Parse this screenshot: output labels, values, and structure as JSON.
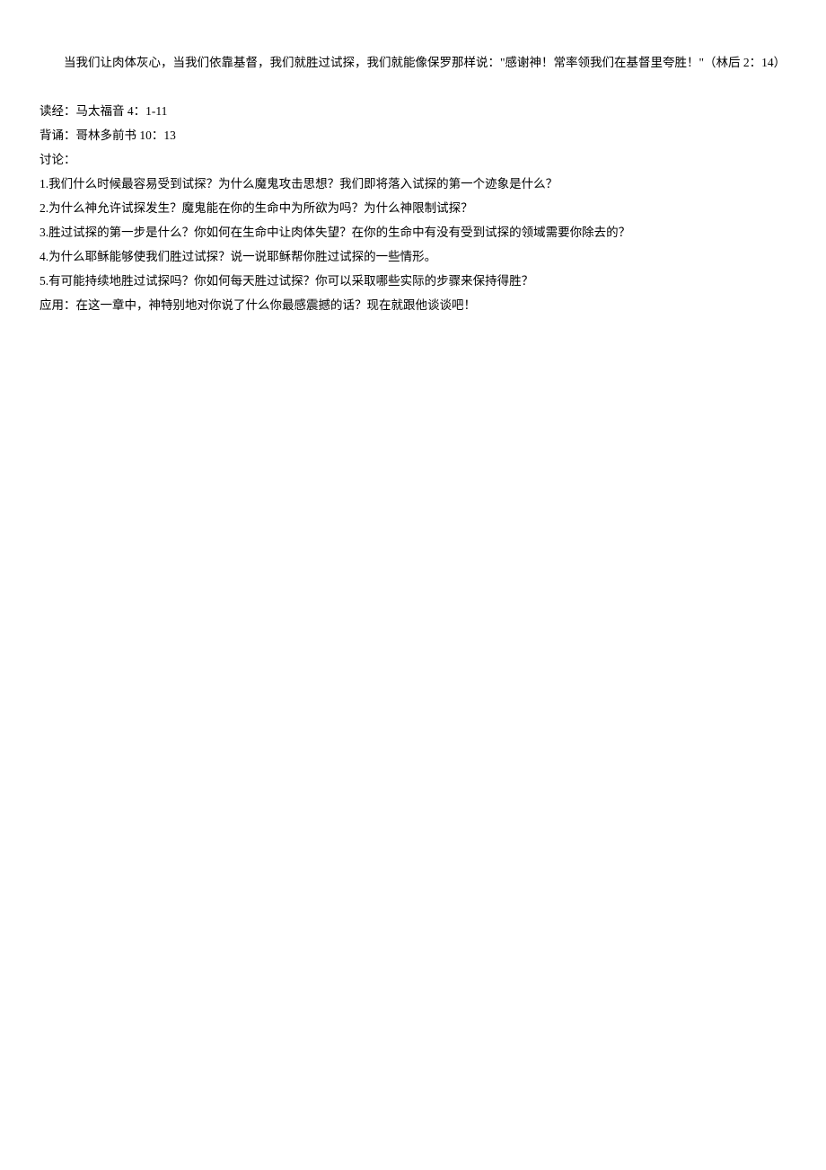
{
  "intro": {
    "paragraph1": "当我们让肉体灰心，当我们依靠基督，我们就胜过试探，我们就能像保罗那样说：\"感谢神！常率领我们在基督里夸胜！\"（林后 2：14）"
  },
  "reading": {
    "label": "读经：",
    "content": "马太福音 4：1-11"
  },
  "memory": {
    "label": "背诵：",
    "content": "哥林多前书 10：13"
  },
  "discussion": {
    "label": "讨论：",
    "questions": [
      "1.我们什么时候最容易受到试探？为什么魔鬼攻击思想？我们即将落入试探的第一个迹象是什么？",
      "2.为什么神允许试探发生？魔鬼能在你的生命中为所欲为吗？为什么神限制试探？",
      "3.胜过试探的第一步是什么？你如何在生命中让肉体失望？在你的生命中有没有受到试探的领域需要你除去的？",
      "4.为什么耶稣能够使我们胜过试探？说一说耶稣帮你胜过试探的一些情形。",
      "5.有可能持续地胜过试探吗？你如何每天胜过试探？你可以采取哪些实际的步骤来保持得胜？"
    ]
  },
  "application": {
    "label": "应用：",
    "content": "在这一章中，神特别地对你说了什么你最感震撼的话？现在就跟他谈谈吧！"
  }
}
